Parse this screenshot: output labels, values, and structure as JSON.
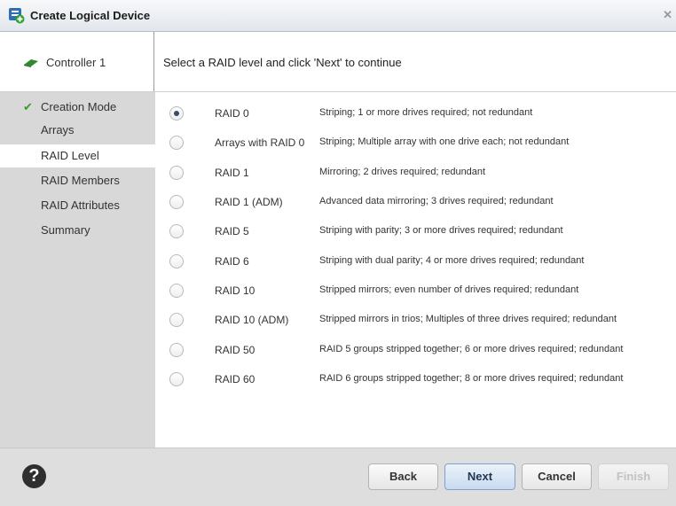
{
  "window": {
    "title": "Create Logical Device",
    "close_glyph": "✕"
  },
  "header": {
    "controller_label": "Controller 1",
    "instruction": "Select a RAID level and click 'Next' to continue"
  },
  "sidebar": {
    "items": [
      {
        "label": "Creation Mode",
        "completed": true
      },
      {
        "label": "Arrays",
        "completed": false
      },
      {
        "label": "RAID Level",
        "completed": false,
        "active": true
      },
      {
        "label": "RAID Members",
        "completed": false
      },
      {
        "label": "RAID Attributes",
        "completed": false
      },
      {
        "label": "Summary",
        "completed": false
      }
    ],
    "check_glyph": "✔"
  },
  "raid_options": [
    {
      "name": "RAID 0",
      "description": "Striping; 1 or more drives required; not redundant",
      "selected": true
    },
    {
      "name": "Arrays with RAID 0",
      "description": "Striping; Multiple array with one drive each; not redundant",
      "selected": false
    },
    {
      "name": "RAID 1",
      "description": "Mirroring; 2 drives required; redundant",
      "selected": false
    },
    {
      "name": "RAID 1 (ADM)",
      "description": "Advanced data mirroring; 3 drives required; redundant",
      "selected": false
    },
    {
      "name": "RAID 5",
      "description": "Striping with parity; 3 or more drives required; redundant",
      "selected": false
    },
    {
      "name": "RAID 6",
      "description": "Striping with dual parity; 4 or more drives required; redundant",
      "selected": false
    },
    {
      "name": "RAID 10",
      "description": "Stripped mirrors; even number of drives required; redundant",
      "selected": false
    },
    {
      "name": "RAID 10 (ADM)",
      "description": "Stripped mirrors in trios; Multiples of three drives required; redundant",
      "selected": false
    },
    {
      "name": "RAID 50",
      "description": "RAID 5 groups stripped together; 6 or more drives required; redundant",
      "selected": false
    },
    {
      "name": "RAID 60",
      "description": "RAID 6 groups stripped together; 8 or more drives required; redundant",
      "selected": false
    }
  ],
  "footer": {
    "help_glyph": "?",
    "back_label": "Back",
    "next_label": "Next",
    "cancel_label": "Cancel",
    "finish_label": "Finish"
  },
  "colors": {
    "check": "#3a9a2a",
    "primary_button": "#c9dbf0",
    "sidebar": "#d8d8d8"
  }
}
